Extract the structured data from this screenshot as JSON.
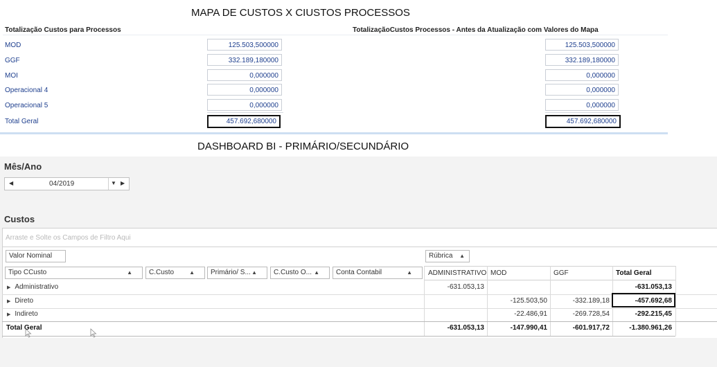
{
  "mapa": {
    "title": "MAPA DE CUSTOS X CIUSTOS PROCESSOS",
    "left": {
      "heading": "Totalização Custos para Processos",
      "rows": [
        {
          "label": "MOD",
          "value": "125.503,500000"
        },
        {
          "label": "GGF",
          "value": "332.189,180000"
        },
        {
          "label": "MOI",
          "value": "0,000000"
        },
        {
          "label": "Operacional 4",
          "value": "0,000000"
        },
        {
          "label": "Operacional 5",
          "value": "0,000000"
        }
      ],
      "total_label": "Total Geral",
      "total_value": "457.692,680000"
    },
    "right": {
      "heading": "TotalizaçãoCustos Processos - Antes da Atualização com Valores do Mapa",
      "values": [
        "125.503,500000",
        "332.189,180000",
        "0,000000",
        "0,000000",
        "0,000000"
      ],
      "total_value": "457.692,680000"
    }
  },
  "dashboard": {
    "title": "DASHBOARD BI - PRIMÁRIO/SECUNDÁRIO",
    "mes_ano": {
      "label": "Mês/Ano",
      "value": "04/2019",
      "prev_icon": "triangle-left-icon",
      "next_icon": "triangle-right-icon",
      "dropdown_icon": "dropdown-arrow-icon"
    },
    "custos": {
      "label": "Custos",
      "filter_placeholder": "Arraste e Solte os Campos de Filtro Aqui",
      "data_field": "Valor Nominal",
      "column_field": "Rúbrica",
      "row_fields": [
        "Tipo CCusto",
        "C.Custo",
        "Primário/ S...",
        "C.Custo O...",
        "Conta Contabil"
      ],
      "columns": [
        "ADMINISTRATIVO",
        "MOD",
        "GGF",
        "Total Geral"
      ],
      "rows": [
        {
          "label": "Administrativo",
          "values": [
            "-631.053,13",
            "",
            "",
            "-631.053,13"
          ]
        },
        {
          "label": "Direto",
          "values": [
            "",
            "-125.503,50",
            "-332.189,18",
            "-457.692,68"
          ]
        },
        {
          "label": "Indireto",
          "values": [
            "",
            "-22.486,91",
            "-269.728,54",
            "-292.215,45"
          ]
        }
      ],
      "total_row": {
        "label": "Total Geral",
        "values": [
          "-631.053,13",
          "-147.990,41",
          "-601.917,72",
          "-1.380.961,26"
        ]
      }
    }
  }
}
